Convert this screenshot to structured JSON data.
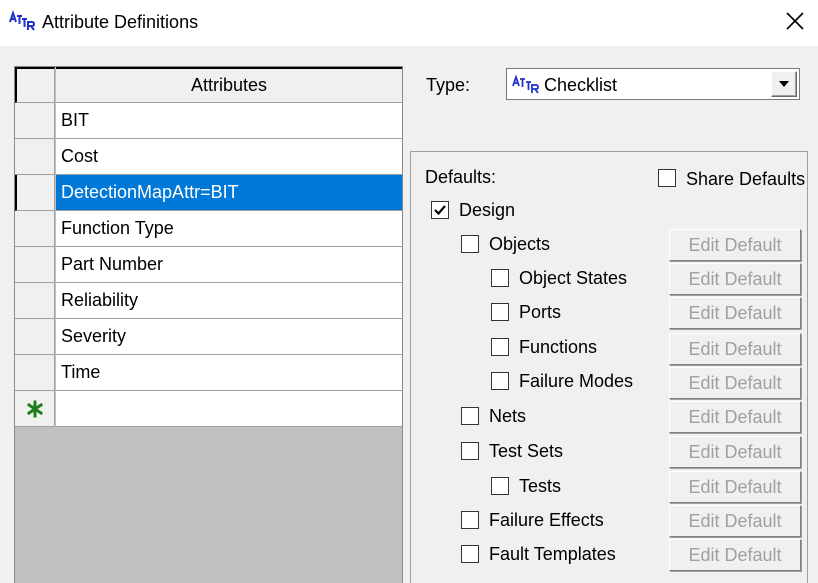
{
  "window": {
    "title": "Attribute Definitions"
  },
  "grid": {
    "column_header": "Attributes",
    "rows": [
      "BIT",
      "Cost",
      "DetectionMapAttr=BIT",
      "Function Type",
      "Part Number",
      "Reliability",
      "Severity",
      "Time"
    ],
    "selected_index": 2
  },
  "type": {
    "label": "Type:",
    "value": "Checklist"
  },
  "defaults": {
    "label": "Defaults:",
    "share_label": "Share Defaults",
    "share_checked": false,
    "design_label": "Design",
    "design_checked": true,
    "edit_label": "Edit Default",
    "items": [
      {
        "label": "Objects",
        "checked": false
      },
      {
        "label": "Object States",
        "checked": false
      },
      {
        "label": "Ports",
        "checked": false
      },
      {
        "label": "Functions",
        "checked": false
      },
      {
        "label": "Failure Modes",
        "checked": false
      },
      {
        "label": "Nets",
        "checked": false
      },
      {
        "label": "Test Sets",
        "checked": false
      },
      {
        "label": "Tests",
        "checked": false
      },
      {
        "label": "Failure Effects",
        "checked": false
      },
      {
        "label": "Fault Templates",
        "checked": false
      }
    ]
  },
  "colors": {
    "selection": "#0078d7",
    "new_row_star": "#1a7f1a",
    "icon_blue": "#2233cc"
  }
}
